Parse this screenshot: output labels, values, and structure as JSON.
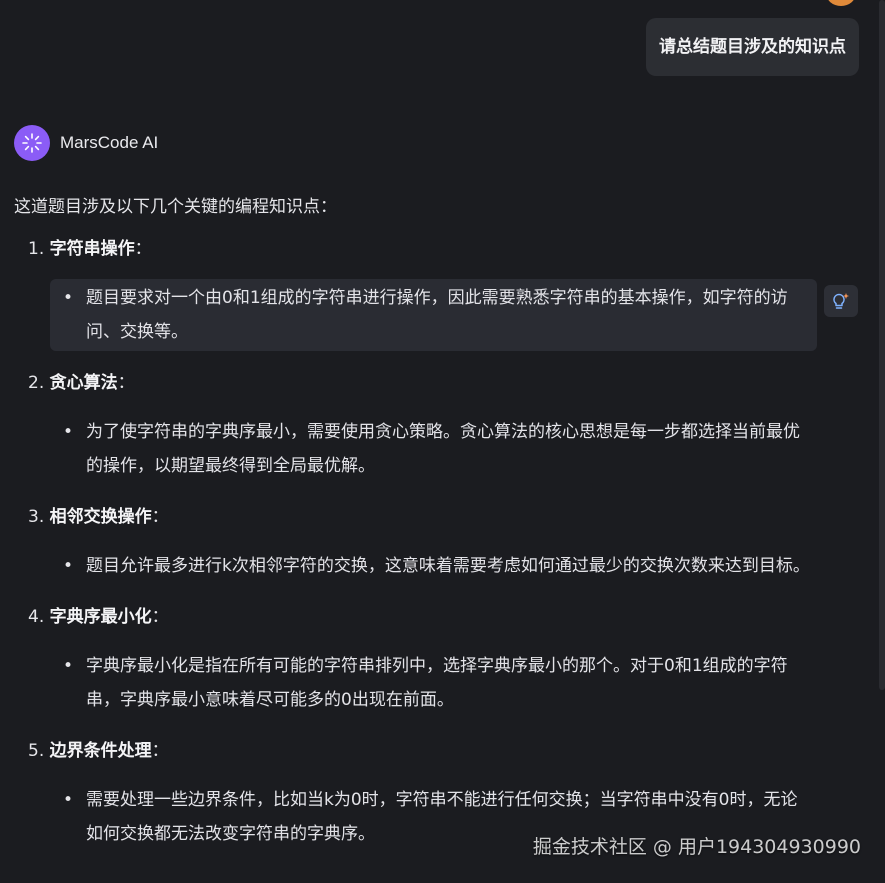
{
  "user": {
    "message": "请总结题目涉及的知识点"
  },
  "assistant": {
    "name": "MarsCode AI",
    "intro": "这道题目涉及以下几个关键的编程知识点：",
    "points": [
      {
        "number": "1.",
        "title": "字符串操作",
        "suffix": "：",
        "text": "题目要求对一个由0和1组成的字符串进行操作，因此需要熟悉字符串的基本操作，如字符的访问、交换等。"
      },
      {
        "number": "2.",
        "title": "贪心算法",
        "suffix": "：",
        "text": "为了使字符串的字典序最小，需要使用贪心策略。贪心算法的核心思想是每一步都选择当前最优的操作，以期望最终得到全局最优解。"
      },
      {
        "number": "3.",
        "title": "相邻交换操作",
        "suffix": "：",
        "text": "题目允许最多进行k次相邻字符的交换，这意味着需要考虑如何通过最少的交换次数来达到目标。"
      },
      {
        "number": "4.",
        "title": "字典序最小化",
        "suffix": "：",
        "text": "字典序最小化是指在所有可能的字符串排列中，选择字典序最小的那个。对于0和1组成的字符串，字典序最小意味着尽可能多的0出现在前面。"
      },
      {
        "number": "5.",
        "title": "边界条件处理",
        "suffix": "：",
        "text": "需要处理一些边界条件，比如当k为0时，字符串不能进行任何交换；当字符串中没有0时，无论如何交换都无法改变字符串的字典序。"
      }
    ]
  },
  "watermark": "掘金技术社区 @ 用户194304930990",
  "colors": {
    "background": "#1b1c20",
    "bubble": "#2c2e33",
    "highlight": "#2a2c33",
    "avatar": "#8b5cf6"
  },
  "icons": {
    "ai_avatar": "sparkle-burst-icon",
    "action": "lightbulb-sparkle-icon"
  }
}
